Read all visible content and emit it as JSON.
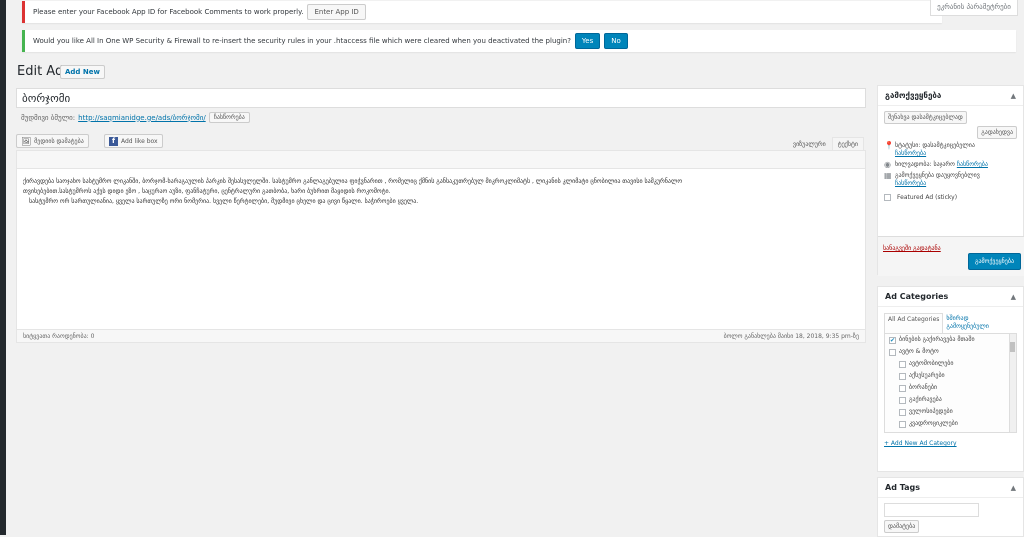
{
  "notices": {
    "facebook": {
      "text": "Please enter your Facebook App ID for Facebook Comments to work properly.",
      "button": "Enter App ID"
    },
    "security": {
      "text": "Would you like All In One WP Security & Firewall to re-insert the security rules in your .htaccess file which were cleared when you deactivated the plugin?",
      "yes": "Yes",
      "no": "No"
    }
  },
  "screen_options": "ეკრანის პარამეტრები",
  "header": {
    "title": "Edit Ad",
    "add_new": "Add New"
  },
  "post": {
    "title": "ბორჯომი",
    "permalink_label": "მუდმივი ბმული:",
    "permalink_url": "http://saqmianidge.ge/ads/ბორჯომი/",
    "permalink_edit": "ჩასწორება"
  },
  "media": {
    "add_media": "მედიის დამატება",
    "add_like_box": "Add like box"
  },
  "editor": {
    "tab_visual": "ვიზუალური",
    "tab_text": "ტექსტი",
    "content_line1": "ქირავდება საოჯახო სასტუმრო ლიკანში, ბორჯომ-ხარაგაულის პარკის შესასვლელში. სასტუმრო განლაგებულია ფიჭვნარით , რომელიც ქმნის განსაკუთრებულ მიკროკლიმატს , ლიკანის კლიმატი ცნობილია თავისი სამკურნალო",
    "content_line2": "თვისებებით.სასტუმროს აქვს დიდი ეზო , საცურაო აუზი, ფანჩატური, ცენტრალური გათბობა, ხარი ბუხრით მაყიდის როკომოტი.",
    "content_line3": "სასტუმრო ორ სართულიანია, ყველა სართულზე ორი ნომერია. სველი წერტილები, მუდმივი ცხელი და ცივი წყალი. საჭიროები ყველა.",
    "word_count": "სიტყვათა რაოდენობა: 0",
    "last_edited": "ბოლო განახლება მაისი 18, 2018, 9:35 pm-ზე"
  },
  "publish_box": {
    "title": "გამოქვეყნება",
    "save_draft": "შენახვა დასამტკიცებლად",
    "preview": "გადახედვა",
    "status_label": "სტატუსი: დასამტკიცებელია",
    "status_edit": "ჩასწორება",
    "visibility_label": "ხილვადობა: საჯარო",
    "visibility_edit": "ჩასწორება",
    "schedule_label": "გამოქვეყნება დაუყოვნებლივ",
    "schedule_edit": "ჩასწორება",
    "featured": "Featured Ad (sticky)",
    "trash": "სანაგვეში გადატანა",
    "publish": "გამოქვეყნება"
  },
  "categories_box": {
    "title": "Ad Categories",
    "tab_all": "All Ad Categories",
    "tab_popular": "ხშირად გამოყენებული",
    "items": [
      {
        "label": "ბინების გაქირავება მთაში",
        "checked": true,
        "indent": 0
      },
      {
        "label": "ავტო & მოტო",
        "checked": false,
        "indent": 0
      },
      {
        "label": "ავტომობილები",
        "checked": false,
        "indent": 1
      },
      {
        "label": "აქსესუარები",
        "checked": false,
        "indent": 1
      },
      {
        "label": "ბორანები",
        "checked": false,
        "indent": 1
      },
      {
        "label": "გაქირავება",
        "checked": false,
        "indent": 1
      },
      {
        "label": "ველოსიპედები",
        "checked": false,
        "indent": 1
      },
      {
        "label": "კვადროციკლები",
        "checked": false,
        "indent": 1
      }
    ],
    "add_new": "+ Add New Ad Category"
  },
  "tags_box": {
    "title": "Ad Tags",
    "add_button": "დამატება"
  }
}
